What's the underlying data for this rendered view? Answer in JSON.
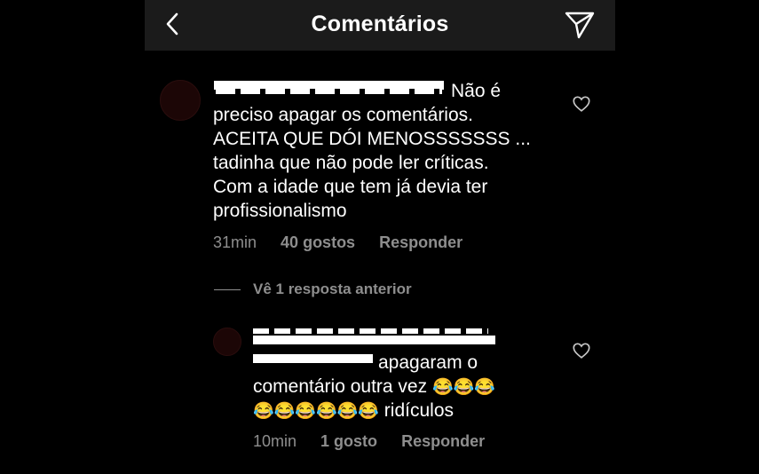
{
  "header": {
    "title": "Comentários"
  },
  "comments": [
    {
      "username_partial": "Não é",
      "text": "preciso apagar os comentários.\nACEITA QUE DÓI MENOSSSSSSS ...\ntadinha que não pode ler críticas.\nCom a idade que tem já devia ter\nprofissionalismo",
      "time": "31min",
      "likes": "40 gostos",
      "reply": "Responder"
    }
  ],
  "view_previous": "Vê 1 resposta anterior",
  "replies": [
    {
      "text_line1": "apagaram o",
      "text_line2": "comentário outra vez",
      "emoji_row1": "😂😂😂",
      "emoji_row2": "😂😂😂😂😂😂",
      "text_tail": "ridículos",
      "time": "10min",
      "likes": "1 gosto",
      "reply": "Responder"
    }
  ],
  "icons": {
    "back": "chevron-left-icon",
    "send": "paper-plane-icon",
    "like": "heart-outline-icon"
  },
  "colors": {
    "background": "#000000",
    "header": "#1b1b1b",
    "secondary_text": "#8e8e8e"
  }
}
